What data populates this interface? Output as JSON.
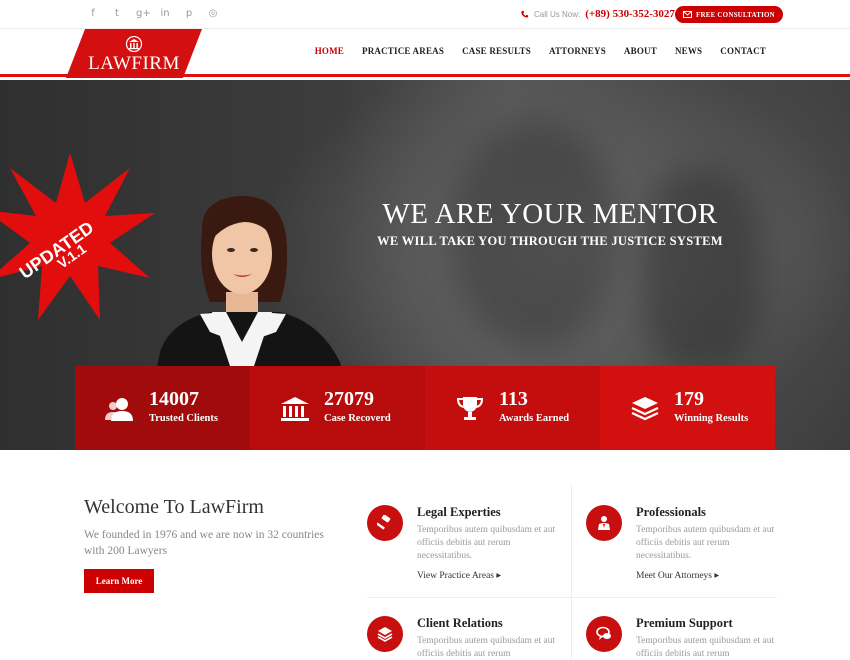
{
  "topbar": {
    "social_icons": [
      {
        "name": "facebook-icon",
        "glyph": "f"
      },
      {
        "name": "twitter-icon",
        "glyph": "t"
      },
      {
        "name": "google-plus-icon",
        "glyph": "g+"
      },
      {
        "name": "linkedin-icon",
        "glyph": "in"
      },
      {
        "name": "pinterest-icon",
        "glyph": "p"
      },
      {
        "name": "dribbble-icon",
        "glyph": "◎"
      }
    ],
    "call_label": "Call Us Now:",
    "phone": "(+89) 530-352-3027",
    "consult_label": "FREE CONSULTATION"
  },
  "brand": {
    "name": "LAWFIRM",
    "accent": "#cc0000"
  },
  "nav": {
    "items": [
      "HOME",
      "PRACTICE AREAS",
      "CASE RESULTS",
      "ATTORNEYS",
      "ABOUT",
      "NEWS",
      "CONTACT"
    ],
    "active": "HOME"
  },
  "hero": {
    "badge_line1": "UPDATED",
    "badge_line2": "V.1.1",
    "title": "WE ARE YOUR MENTOR",
    "subtitle": "WE WILL TAKE YOU THROUGH THE JUSTICE SYSTEM"
  },
  "stats": [
    {
      "icon": "users-icon",
      "value": "14007",
      "label": "Trusted Clients",
      "bg": "#a10b0b"
    },
    {
      "icon": "courthouse-icon",
      "value": "27079",
      "label": "Case Recoverd",
      "bg": "#b80c0c"
    },
    {
      "icon": "trophy-icon",
      "value": "113",
      "label": "Awards Earned",
      "bg": "#c40e0e"
    },
    {
      "icon": "layers-icon",
      "value": "179",
      "label": "Winning Results",
      "bg": "#d31010"
    }
  ],
  "welcome": {
    "title": "Welcome To LawFirm",
    "text": "We founded in 1976 and we are now in 32 countries with 200 Lawyers",
    "button": "Learn More"
  },
  "features": [
    {
      "icon": "gavel-icon",
      "title": "Legal Experties",
      "desc": "Temporibus autem quibusdam et aut officiis debitis aut rerum necessitatibus.",
      "link": "View Practice Areas"
    },
    {
      "icon": "attorney-icon",
      "title": "Professionals",
      "desc": "Temporibus autem quibusdam et aut officiis debitis aut rerum necessitatibus.",
      "link": "Meet Our Attorneys"
    },
    {
      "icon": "handshake-icon",
      "title": "Client Relations",
      "desc": "Temporibus autem quibusdam et aut officiis debitis aut rerum",
      "link": ""
    },
    {
      "icon": "chat-icon",
      "title": "Premium Support",
      "desc": "Temporibus autem quibusdam et aut officiis debitis aut rerum",
      "link": ""
    }
  ]
}
